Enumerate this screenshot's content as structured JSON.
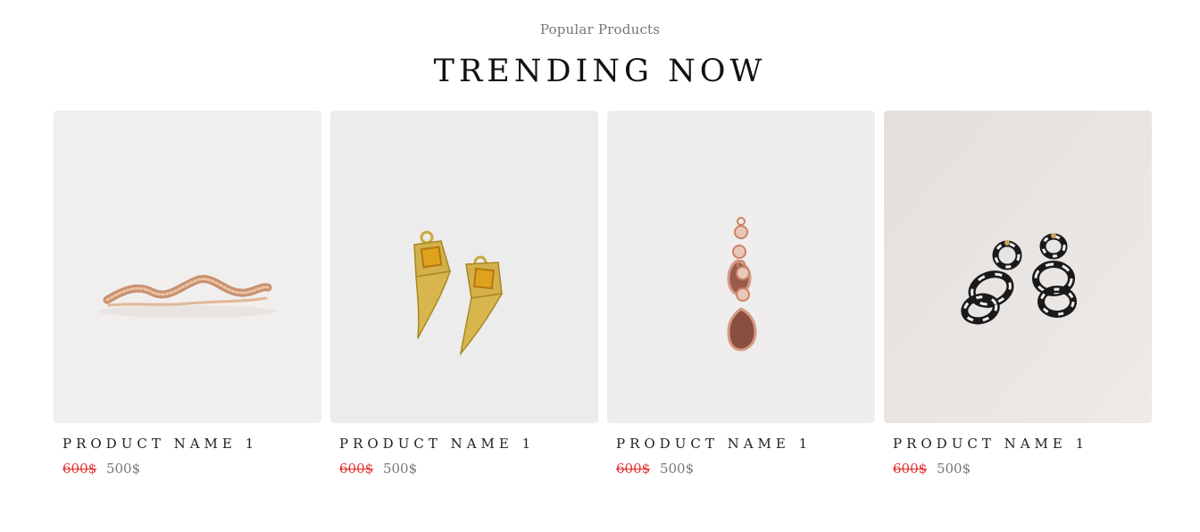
{
  "section": {
    "kicker": "Popular Products",
    "title": "TRENDING NOW"
  },
  "products": [
    {
      "name": "PRODUCT NAME 1",
      "old_price": "600$",
      "new_price": "500$",
      "image": "rose-gold-wave-ring",
      "background": "#f1eeee"
    },
    {
      "name": "PRODUCT NAME 1",
      "old_price": "600$",
      "new_price": "500$",
      "image": "gold-citrine-horn-earrings",
      "background": "#ececed"
    },
    {
      "name": "PRODUCT NAME 1",
      "old_price": "600$",
      "new_price": "500$",
      "image": "rose-gold-drop-earrings",
      "background": "#efeded"
    },
    {
      "name": "PRODUCT NAME 1",
      "old_price": "600$",
      "new_price": "500$",
      "image": "black-white-chain-earrings",
      "background": "#e9e6e5"
    }
  ],
  "colors": {
    "sale_strike": "#e0302f",
    "price_text": "#777777",
    "heading": "#111111"
  }
}
